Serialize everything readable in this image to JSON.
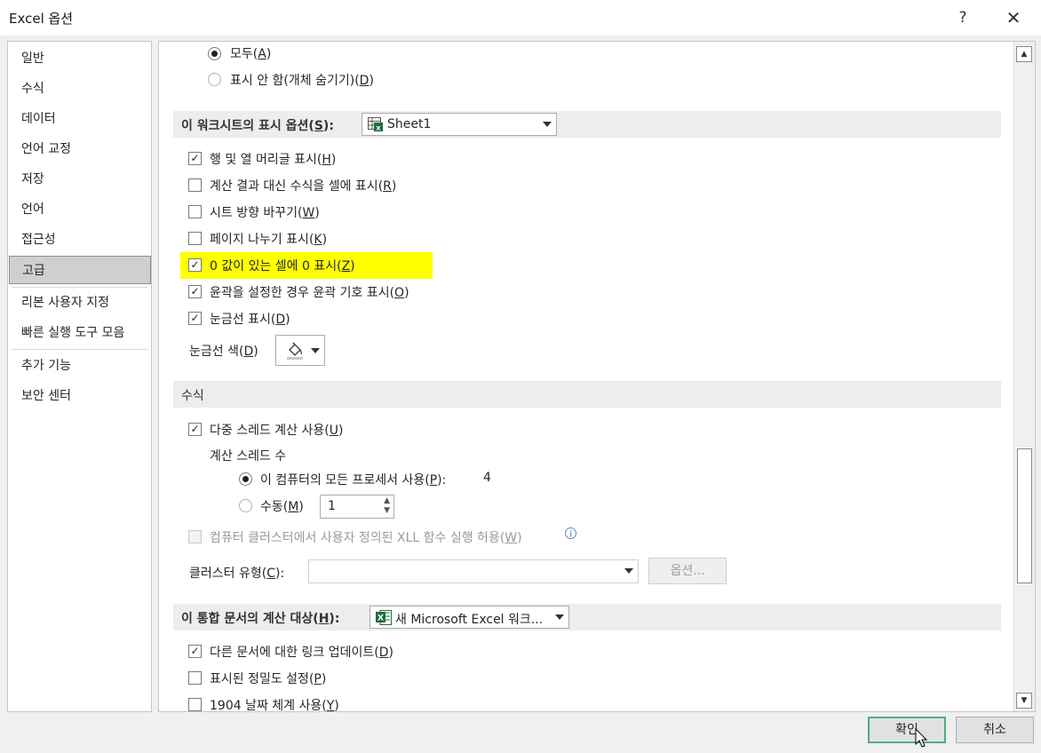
{
  "window": {
    "title": "Excel 옵션",
    "help_glyph": "?",
    "close_glyph": "✕"
  },
  "nav": {
    "items": [
      "일반",
      "수식",
      "데이터",
      "언어 교정",
      "저장",
      "언어",
      "접근성",
      "고급",
      "리본 사용자 지정",
      "빠른 실행 도구 모음",
      "추가 기능",
      "보안 센터"
    ],
    "selected": "고급"
  },
  "objects": {
    "all": {
      "text": "모두(",
      "key": "A",
      "end": ")"
    },
    "hide": {
      "text": "표시 안 함(개체 숨기기)(",
      "key": "D",
      "end": ")"
    }
  },
  "sheet_section": {
    "label_prefix": "이 워크시트의 표시 옵션(",
    "label_key": "S",
    "label_suffix": "):",
    "sheet_select": "Sheet1",
    "options": [
      {
        "text": "행 및 열 머리글 표시(",
        "key": "H",
        "end": ")",
        "checked": "✓"
      },
      {
        "text": "계산 결과 대신 수식을 셀에 표시(",
        "key": "R",
        "end": ")",
        "checked": ""
      },
      {
        "text": "시트 방향 바꾸기(",
        "key": "W",
        "end": ")",
        "checked": ""
      },
      {
        "text": "페이지 나누기 표시(",
        "key": "K",
        "end": ")",
        "checked": ""
      },
      {
        "text": "0 값이 있는 셀에 0 표시(",
        "key": "Z",
        "end": ")",
        "checked": "✓"
      },
      {
        "text": "윤곽을 설정한 경우 윤곽 기호 표시(",
        "key": "O",
        "end": ")",
        "checked": "✓"
      },
      {
        "text": "눈금선 표시(",
        "key": "D",
        "end": ")",
        "checked": "✓"
      }
    ],
    "gridline_color_label": {
      "text": "눈금선 색(",
      "key": "D",
      "end": ")"
    }
  },
  "formula_section": {
    "label": "수식",
    "multithread": {
      "text": "다중 스레드 계산 사용(",
      "key": "U",
      "end": ")",
      "checked": "✓"
    },
    "thread_count_label": "계산 스레드 수",
    "all_processors": {
      "text": "이 컴퓨터의 모든 프로세서 사용(",
      "key": "P",
      "end": "):",
      "value": "4"
    },
    "manual": {
      "text": "수동(",
      "key": "M",
      "end": ")",
      "value": "1"
    },
    "xll": {
      "text": "컴퓨터 클러스터에서 사용자 정의된 XLL 함수 실행 허용(",
      "key": "W",
      "end": ")"
    },
    "cluster_type": {
      "text": "클러스터 유형(",
      "key": "C",
      "end": "):",
      "options_button": "옵션..."
    }
  },
  "workbook_section": {
    "label_prefix": "이 통합 문서의 계산 대상(",
    "label_key": "H",
    "label_suffix": "):",
    "workbook_select": "새 Microsoft Excel 워크...",
    "options": [
      {
        "text": "다른 문서에 대한 링크 업데이트(",
        "key": "D",
        "end": ")",
        "checked": "✓"
      },
      {
        "text": "표시된 정밀도 설정(",
        "key": "P",
        "end": ")",
        "checked": ""
      },
      {
        "text": "1904 날짜 체계 사용(",
        "key": "Y",
        "end": ")",
        "checked": ""
      }
    ]
  },
  "buttons": {
    "ok": "확인",
    "cancel": "취소"
  },
  "colors": {
    "highlight": "#ffff00",
    "excel_green": "#1d6f42",
    "ok_border": "#4faf7a"
  }
}
